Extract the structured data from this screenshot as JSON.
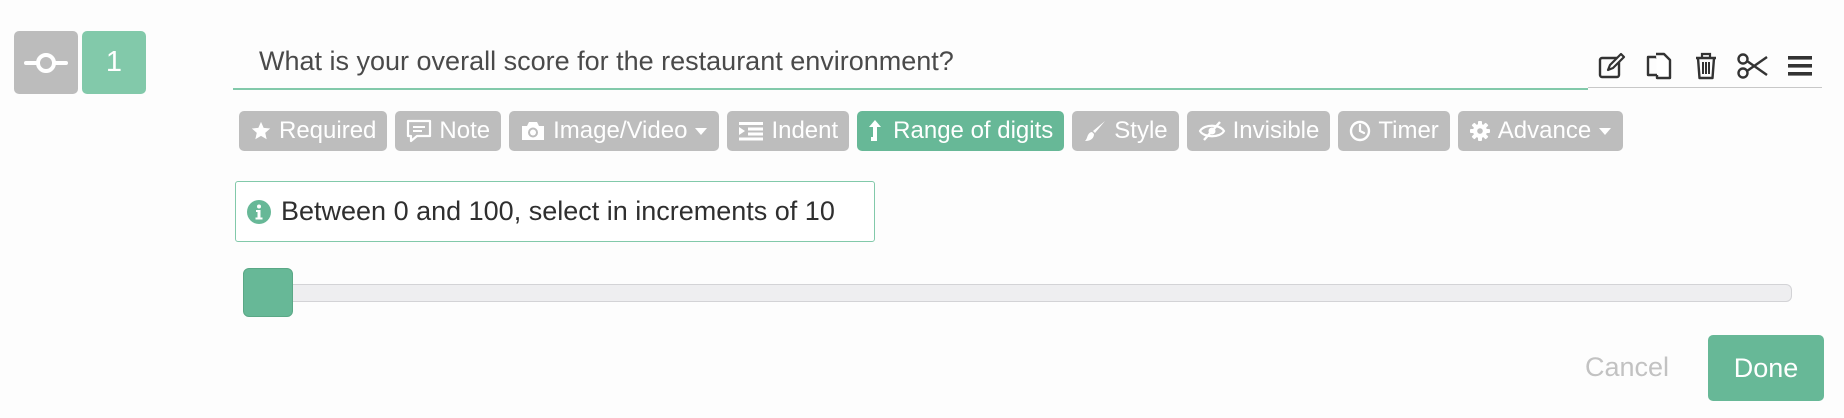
{
  "question": {
    "number": "1",
    "text": "What is your overall score for the restaurant environment?",
    "type_icon": "slider-icon"
  },
  "toolbar": {
    "icons": [
      "edit-icon",
      "copy-icon",
      "trash-icon",
      "scissors-icon",
      "menu-icon"
    ]
  },
  "options": {
    "required": "Required",
    "note": "Note",
    "image_video": "Image/Video",
    "indent": "Indent",
    "range_of_digits": "Range of digits",
    "style": "Style",
    "invisible": "Invisible",
    "timer": "Timer",
    "advance": "Advance",
    "active": "range_of_digits"
  },
  "hint": {
    "text": "Between 0 and 100, select in increments of 10",
    "icon": "info-icon"
  },
  "slider": {
    "min": 0,
    "max": 100,
    "step": 10,
    "value": 0
  },
  "actions": {
    "cancel": "Cancel",
    "done": "Done"
  },
  "colors": {
    "accent": "#67b897",
    "accent_light": "#82c9aa",
    "pill_inactive": "#bdbdbd",
    "badge_gray": "#bcbcbc"
  }
}
